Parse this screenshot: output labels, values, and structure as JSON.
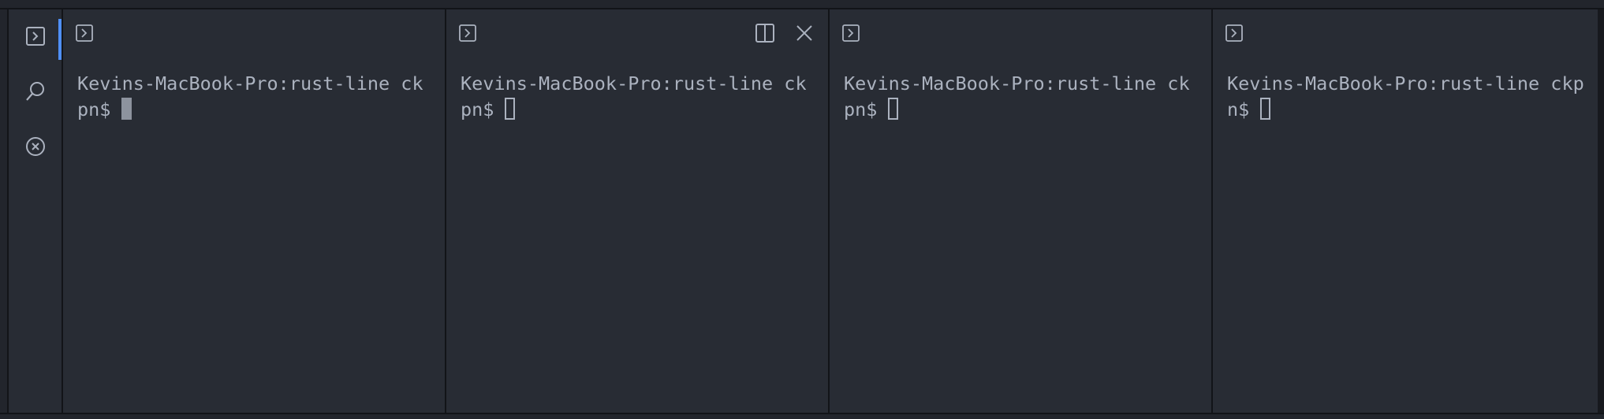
{
  "activity_bar": {
    "items": [
      {
        "icon": "terminal-icon",
        "active": true
      },
      {
        "icon": "search-icon",
        "active": false
      },
      {
        "icon": "close-circle-icon",
        "active": false
      }
    ],
    "accent_color": "#4f8ff7"
  },
  "panes": [
    {
      "line1": "Kevins-MacBook-Pro:rust-line ck",
      "line2": "pn$",
      "cursor": "filled",
      "focused": false
    },
    {
      "line1": "Kevins-MacBook-Pro:rust-line ck",
      "line2": "pn$",
      "cursor": "hollow",
      "focused": true,
      "actions": [
        "split-pane-icon",
        "close-icon"
      ]
    },
    {
      "line1": "Kevins-MacBook-Pro:rust-line ck",
      "line2": "pn$",
      "cursor": "hollow",
      "focused": false
    },
    {
      "line1": "Kevins-MacBook-Pro:rust-line ckp",
      "line2": "n$",
      "cursor": "hollow",
      "focused": false
    }
  ],
  "colors": {
    "background": "#282c34",
    "text": "#abb2bf",
    "border": "#121418"
  }
}
